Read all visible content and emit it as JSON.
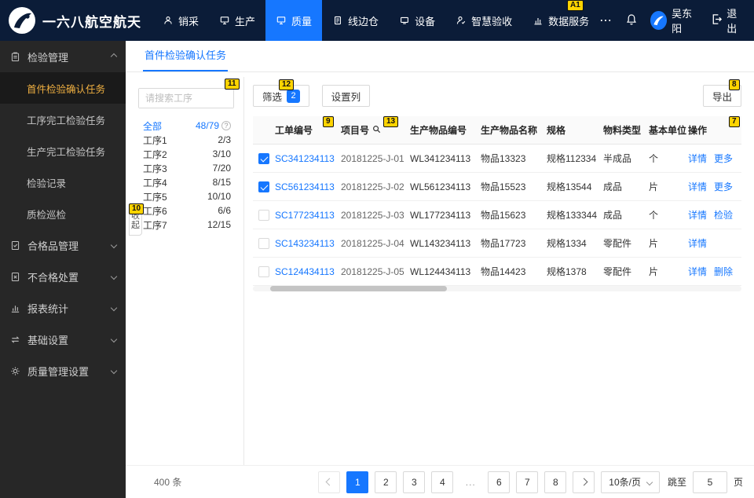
{
  "colors": {
    "accent": "#1677ff",
    "topbar_bg": "#0b1c38",
    "sidebar_bg": "#272727",
    "active_menu_item": "#efaf41",
    "marker_bg": "#ffd400"
  },
  "topbar": {
    "brand": "一六八航空航天",
    "nav": [
      {
        "label": "销采",
        "icon": "procurement-icon"
      },
      {
        "label": "生产",
        "icon": "production-icon"
      },
      {
        "label": "质量",
        "icon": "quality-icon"
      },
      {
        "label": "线边仓",
        "icon": "warehouse-icon"
      },
      {
        "label": "设备",
        "icon": "equipment-icon"
      },
      {
        "label": "智慧验收",
        "icon": "acceptance-icon"
      },
      {
        "label": "数据服务",
        "icon": "data-service-icon"
      },
      {
        "label": "⋯",
        "icon": "more-icon"
      }
    ],
    "user_name": "吴东阳",
    "logout_label": "退出"
  },
  "sidebar": {
    "groups": [
      {
        "label": "检验管理"
      },
      {
        "label": "合格品管理"
      },
      {
        "label": "不合格处置"
      },
      {
        "label": "报表统计"
      },
      {
        "label": "基础设置"
      },
      {
        "label": "质量管理设置"
      }
    ],
    "inspection_items": [
      {
        "label": "首件检验确认任务"
      },
      {
        "label": "工序完工检验任务"
      },
      {
        "label": "生产完工检验任务"
      },
      {
        "label": "检验记录"
      },
      {
        "label": "质检巡检"
      }
    ]
  },
  "tabbar": {
    "active_tab": "首件检验确认任务"
  },
  "process_panel": {
    "search_placeholder": "请搜索工序",
    "all_label": "全部",
    "all_count": "48/79",
    "collapse_char_1": "收",
    "collapse_char_2": "起",
    "items": [
      {
        "label": "工序1",
        "count": "2/3"
      },
      {
        "label": "工序2",
        "count": "3/10"
      },
      {
        "label": "工序3",
        "count": "7/20"
      },
      {
        "label": "工序4",
        "count": "8/15"
      },
      {
        "label": "工序5",
        "count": "10/10"
      },
      {
        "label": "工序6",
        "count": "6/6"
      },
      {
        "label": "工序7",
        "count": "12/15"
      }
    ]
  },
  "toolbar": {
    "filter_label": "筛选",
    "filter_count": "2",
    "columns_label": "设置列",
    "export_label": "导出"
  },
  "table": {
    "headers": [
      "工单编号",
      "项目号",
      "生产物品编号",
      "生产物品名称",
      "规格",
      "物料类型",
      "基本单位",
      "操作"
    ],
    "rows": [
      {
        "checked": true,
        "order_no": "SC341234113",
        "project_no": "20181225-J-01",
        "item_no": "WL341234113",
        "item_name": "物品13323",
        "spec": "规格112334",
        "material_type": "半成品",
        "unit": "个",
        "action1": "详情",
        "action2": "更多"
      },
      {
        "checked": true,
        "order_no": "SC561234113",
        "project_no": "20181225-J-02",
        "item_no": "WL561234113",
        "item_name": "物品15523",
        "spec": "规格13544",
        "material_type": "成品",
        "unit": "片",
        "action1": "详情",
        "action2": "更多"
      },
      {
        "checked": false,
        "order_no": "SC177234113",
        "project_no": "20181225-J-03",
        "item_no": "WL177234113",
        "item_name": "物品15623",
        "spec": "规格133344",
        "material_type": "成品",
        "unit": "个",
        "action1": "详情",
        "action2": "检验"
      },
      {
        "checked": false,
        "order_no": "SC143234113",
        "project_no": "20181225-J-04",
        "item_no": "WL143234113",
        "item_name": "物品17723",
        "spec": "规格1334",
        "material_type": "零配件",
        "unit": "片",
        "action1": "详情",
        "action2": ""
      },
      {
        "checked": false,
        "order_no": "SC124434113",
        "project_no": "20181225-J-05",
        "item_no": "WL124434113",
        "item_name": "物品14423",
        "spec": "规格1378",
        "material_type": "零配件",
        "unit": "片",
        "action1": "详情",
        "action2": "删除"
      }
    ]
  },
  "footer": {
    "total": "400 条",
    "pages": [
      "1",
      "2",
      "3",
      "4",
      "...",
      "6",
      "7",
      "8"
    ],
    "page_size": "10条/页",
    "jump_label": "跳至",
    "jump_value": "5",
    "jump_suffix": "页"
  },
  "annotations": {
    "labels": [
      "A1",
      "11",
      "12",
      "9",
      "13",
      "7",
      "8",
      "10"
    ]
  }
}
